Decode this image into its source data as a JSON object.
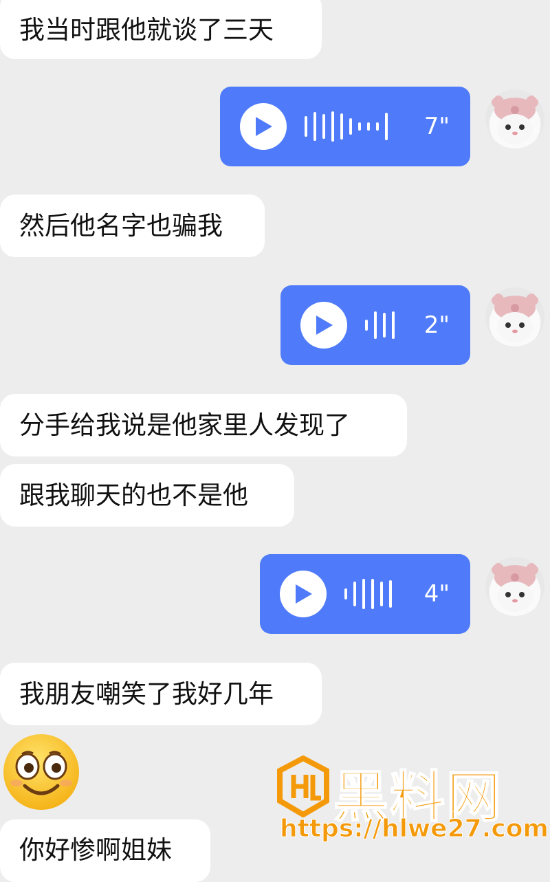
{
  "messages": {
    "m1": "我当时跟他就谈了三天",
    "m2": "然后他名字也骗我",
    "m3": "分手给我说是他家里人发现了",
    "m4": "跟我聊天的也不是他",
    "m5": "我朋友嘲笑了我好几年",
    "m6": "你好惨啊姐妹"
  },
  "voices": {
    "v1": {
      "duration": "7\""
    },
    "v2": {
      "duration": "2\""
    },
    "v3": {
      "duration": "4\""
    }
  },
  "emoji": {
    "icon": "smiling-face-emoji-icon"
  },
  "watermark": {
    "title": "黑料网",
    "url": "https://hlwe27.com",
    "color": "#f49a0a"
  },
  "colors": {
    "voice_bubble": "#4f7bfa",
    "text_bubble": "#ffffff",
    "background": "#ededed"
  }
}
